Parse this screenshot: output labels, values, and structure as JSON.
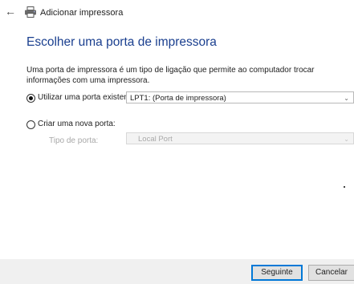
{
  "window": {
    "title": "Adicionar impressora",
    "back_icon": "back-arrow-icon",
    "title_icon": "printer-icon"
  },
  "page": {
    "heading": "Escolher uma porta de impressora",
    "description": "Uma porta de impressora é um tipo de ligação que permite ao computador trocar informações com uma impressora."
  },
  "options": {
    "existing": {
      "label": "Utilizar uma porta existente:",
      "selected": true,
      "value": "LPT1: (Porta de impressora)"
    },
    "new": {
      "label": "Criar uma nova porta:",
      "selected": false,
      "port_type_label": "Tipo de porta:",
      "port_type_value": "Local Port"
    }
  },
  "buttons": {
    "next": "Seguinte",
    "cancel": "Cancelar"
  },
  "colors": {
    "heading": "#1a3f8f",
    "primary_border": "#0078d7",
    "footer_bg": "#f0f0f0"
  }
}
